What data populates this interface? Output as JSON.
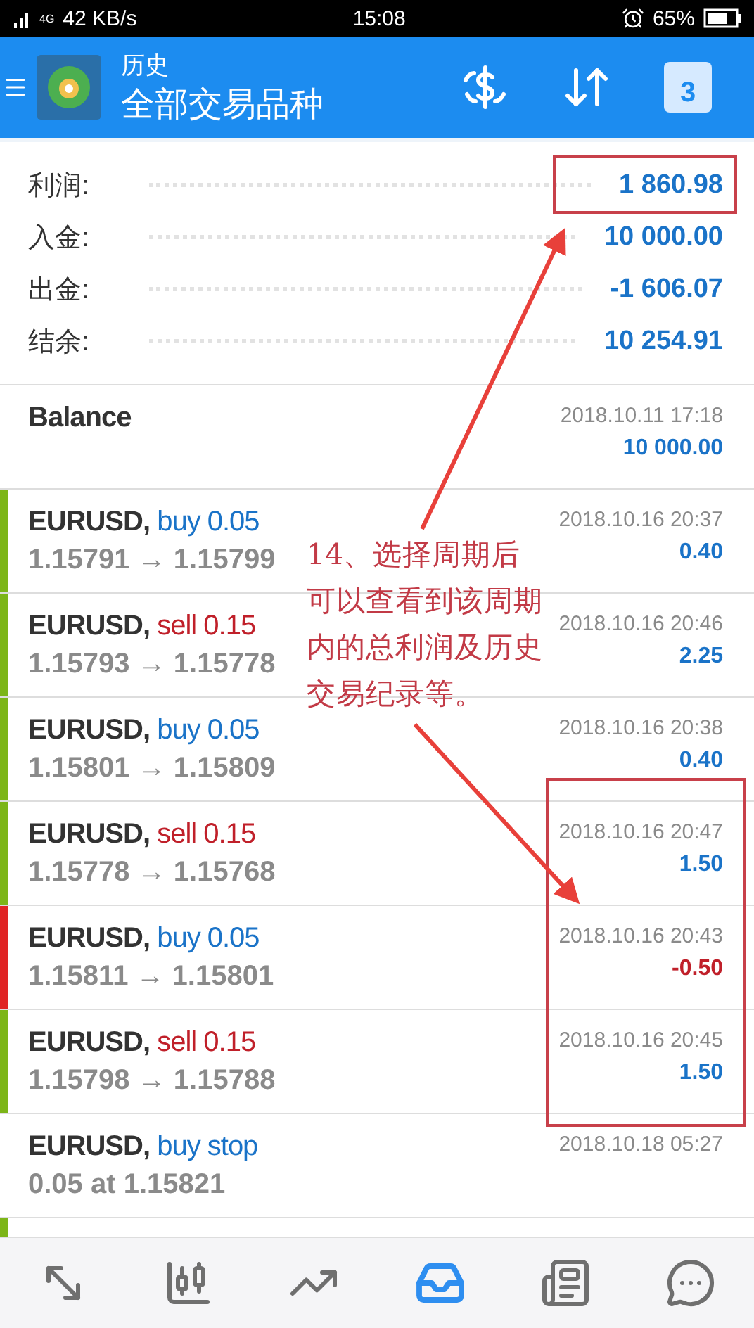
{
  "status_bar": {
    "network": "4G",
    "speed": "42 KB/s",
    "time": "15:08",
    "battery": "65%"
  },
  "header": {
    "title": "历史",
    "subtitle": "全部交易品种",
    "calendar_day": "3"
  },
  "summary": [
    {
      "label": "利润:",
      "value": "1 860.98"
    },
    {
      "label": "入金:",
      "value": "10 000.00"
    },
    {
      "label": "出金:",
      "value": "-1 606.07"
    },
    {
      "label": "结余:",
      "value": "10 254.91"
    }
  ],
  "rows": [
    {
      "kind": "balance",
      "title": "Balance",
      "time": "2018.10.11 17:18",
      "amount": {
        "text": "10 000.00",
        "color": "#1a73c8"
      }
    },
    {
      "kind": "deal",
      "color": "#7cb518",
      "symbol": "EURUSD,",
      "side": {
        "text": "buy 0.05",
        "color": "#1a73c8"
      },
      "detail": "1.15791 → 1.15799",
      "time": "2018.10.16 20:37",
      "amount": {
        "text": "0.40",
        "color": "#1a73c8"
      }
    },
    {
      "kind": "deal",
      "color": "#7cb518",
      "symbol": "EURUSD,",
      "side": {
        "text": "sell 0.15",
        "color": "#c0202a"
      },
      "detail": "1.15793 → 1.15778",
      "time": "2018.10.16 20:46",
      "amount": {
        "text": "2.25",
        "color": "#1a73c8"
      }
    },
    {
      "kind": "deal",
      "color": "#7cb518",
      "symbol": "EURUSD,",
      "side": {
        "text": "buy 0.05",
        "color": "#1a73c8"
      },
      "detail": "1.15801 → 1.15809",
      "time": "2018.10.16 20:38",
      "amount": {
        "text": "0.40",
        "color": "#1a73c8"
      }
    },
    {
      "kind": "deal",
      "color": "#7cb518",
      "symbol": "EURUSD,",
      "side": {
        "text": "sell 0.15",
        "color": "#c0202a"
      },
      "detail": "1.15778 → 1.15768",
      "time": "2018.10.16 20:47",
      "amount": {
        "text": "1.50",
        "color": "#1a73c8"
      }
    },
    {
      "kind": "deal",
      "color": "#e02424",
      "symbol": "EURUSD,",
      "side": {
        "text": "buy 0.05",
        "color": "#1a73c8"
      },
      "detail": "1.15811 → 1.15801",
      "time": "2018.10.16 20:43",
      "amount": {
        "text": "-0.50",
        "color": "#c0202a"
      }
    },
    {
      "kind": "deal",
      "color": "#7cb518",
      "symbol": "EURUSD,",
      "side": {
        "text": "sell 0.15",
        "color": "#c0202a"
      },
      "detail": "1.15798 → 1.15788",
      "time": "2018.10.16 20:45",
      "amount": {
        "text": "1.50",
        "color": "#1a73c8"
      }
    },
    {
      "kind": "deal",
      "symbol": "EURUSD,",
      "side": {
        "text": "buy stop",
        "color": "#1a73c8"
      },
      "detail": "0.05 at 1.15821",
      "time": "2018.10.18 05:27"
    },
    {
      "kind": "stub",
      "color": "#7cb518"
    }
  ],
  "nav": [
    {
      "kind": "trade",
      "selected": false
    },
    {
      "kind": "quotes",
      "selected": false
    },
    {
      "kind": "chart",
      "selected": false
    },
    {
      "kind": "history",
      "selected": true
    },
    {
      "kind": "news",
      "selected": false
    },
    {
      "kind": "chat",
      "selected": false
    }
  ],
  "annotation": {
    "text": [
      "14、选择周期后",
      "可以查看到该周期",
      "内的总利润及历史",
      "交易纪录等。"
    ]
  }
}
